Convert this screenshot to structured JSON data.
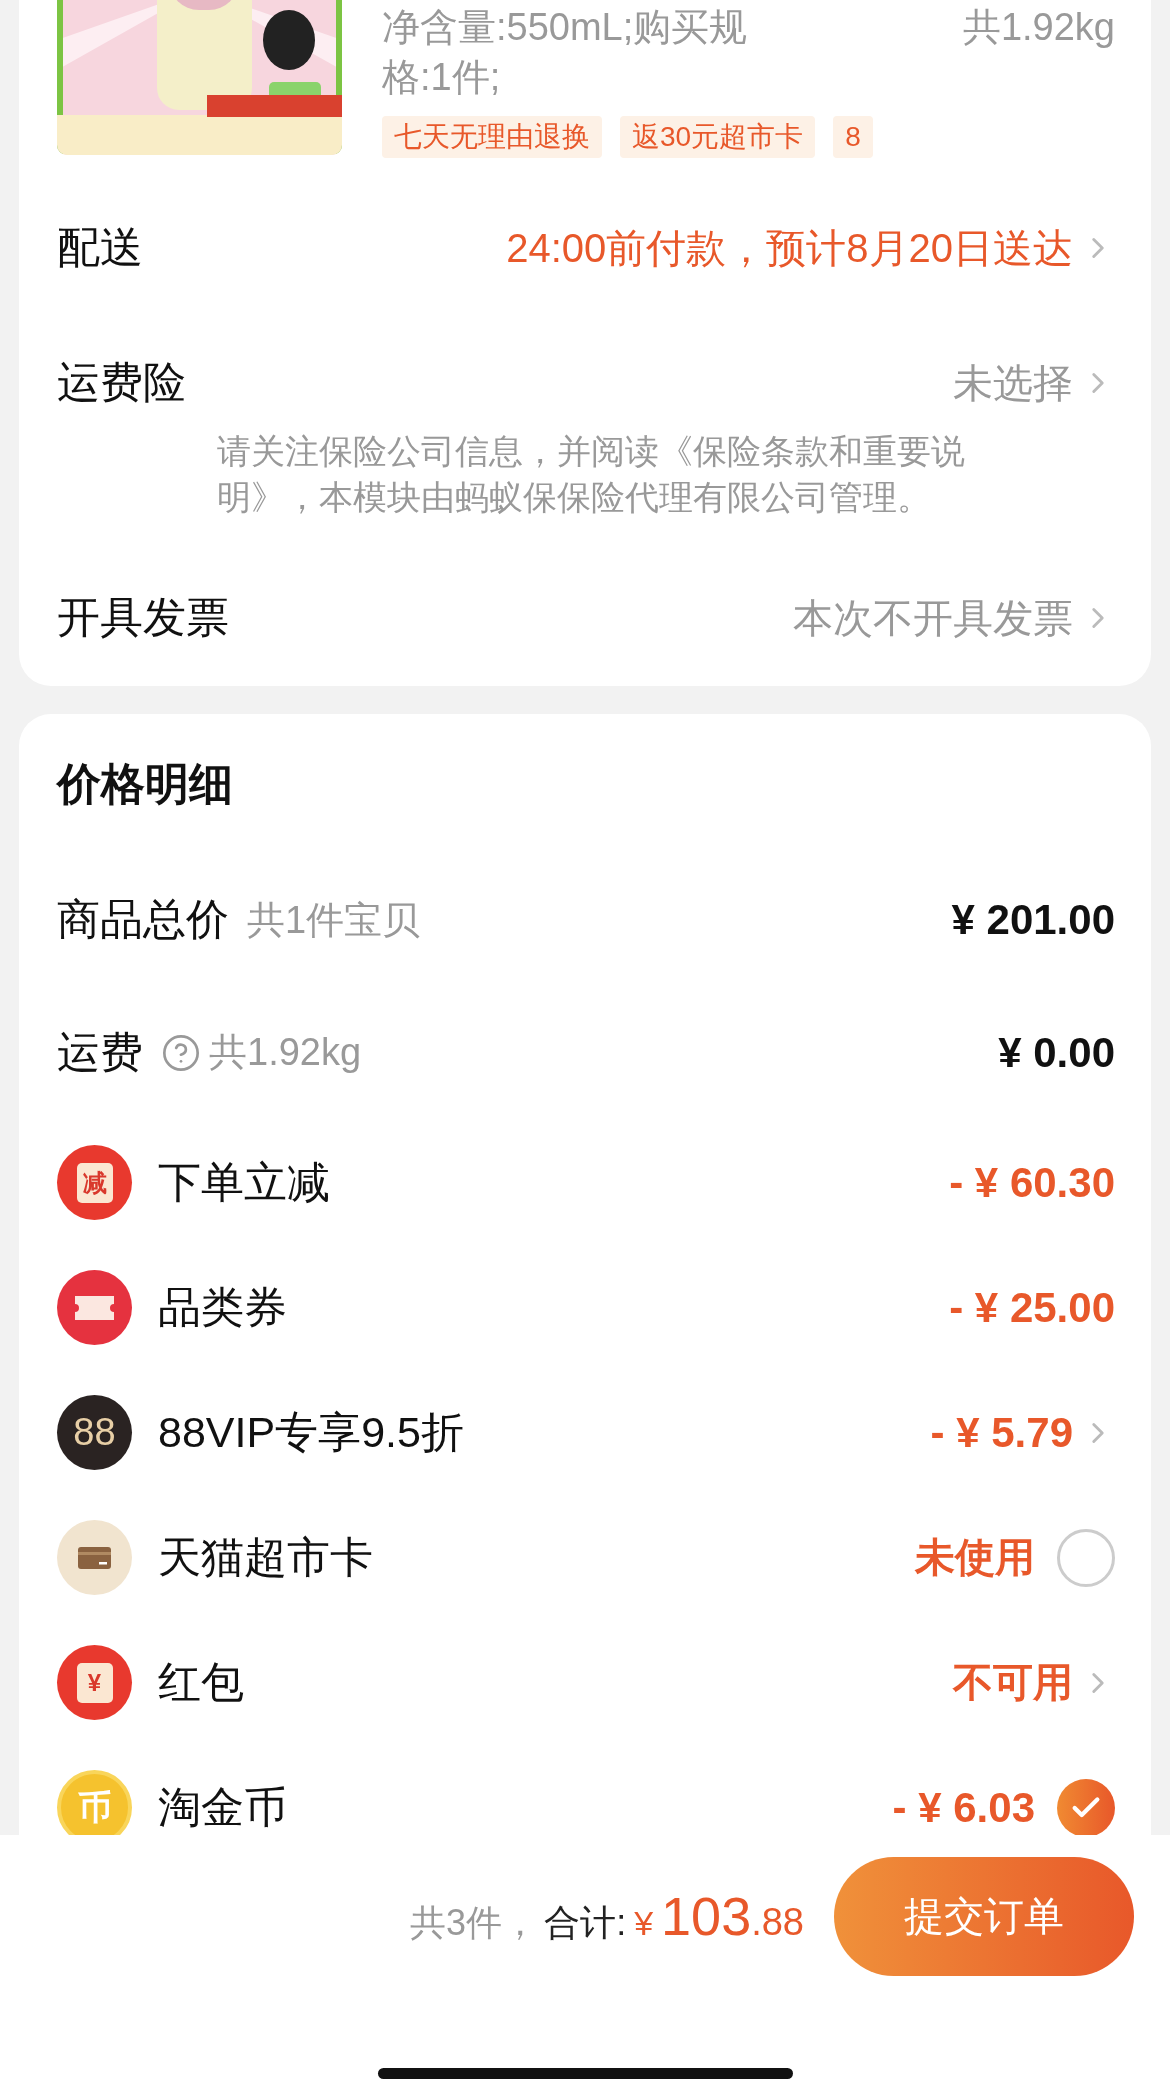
{
  "product": {
    "picture": {
      "kind": "picture"
    },
    "spec_lines": [
      "净含量:550mL;购买规",
      "格:1件;"
    ],
    "weight": "共1.92kg",
    "tags": [
      "七天无理由退换",
      "返30元超市卡",
      "8"
    ]
  },
  "order_rows": [
    {
      "label": "配送",
      "value": "24:00前付款，预计8月20日送达",
      "highlighted": true,
      "chevron": true
    },
    {
      "label": "运费险",
      "value": "未选择",
      "highlighted": false,
      "chevron": true,
      "note": "请关注保险公司信息，并阅读《保险条款和重要说明》，本模块由蚂蚁保保险代理有限公司管理。"
    },
    {
      "label": "开具发票",
      "value": "本次不开具发票",
      "highlighted": false,
      "chevron": true
    }
  ],
  "price_detail": {
    "title": "价格明细",
    "totals": [
      {
        "label": "商品总价",
        "sub": "共1件宝贝",
        "amount": "¥ 201.00",
        "help": false
      },
      {
        "label": "运费",
        "sub": "共1.92kg",
        "amount": "¥ 0.00",
        "help": true
      }
    ],
    "discounts": [
      {
        "kind": "reduce",
        "icon_text": "减",
        "label": "下单立减",
        "value": "- ¥ 60.30",
        "chevron": false
      },
      {
        "kind": "coupon",
        "label": "品类券",
        "value": "- ¥ 25.00",
        "chevron": false
      },
      {
        "kind": "vip",
        "icon_text": "88",
        "label": "88VIP专享9.5折",
        "value": "- ¥ 5.79",
        "chevron": true
      },
      {
        "kind": "card",
        "label": "天猫超市卡",
        "value": "未使用",
        "chevron": false,
        "checked": false
      },
      {
        "kind": "envelope",
        "icon_text": "¥",
        "label": "红包",
        "value": "不可用",
        "chevron": true
      },
      {
        "kind": "coin",
        "icon_text": "币",
        "label": "淘金币",
        "value": "- ¥ 6.03",
        "chevron": false,
        "checked": true
      }
    ]
  },
  "footer": {
    "count": "共3件，",
    "total_label": "合计:",
    "currency": "¥",
    "integer": "103",
    "decimals": ".88",
    "submit": "提交订单"
  }
}
